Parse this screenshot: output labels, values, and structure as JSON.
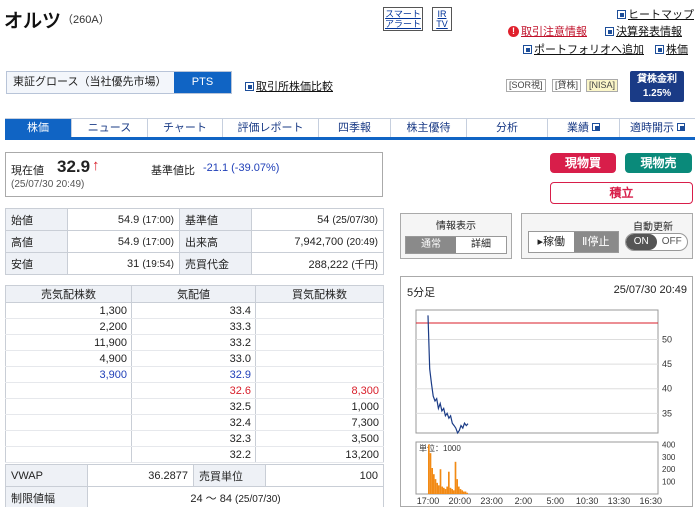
{
  "header": {
    "name": "オルツ",
    "code": "（260A）",
    "smart_alert": [
      "スマート",
      "アラート"
    ],
    "irtv": [
      "IR",
      "TV"
    ],
    "links": {
      "heatmap": "ヒートマップ",
      "caution": "取引注意情報",
      "earnings": "決算発表情報",
      "portfolio": "ポートフォリオへ追加",
      "board": "株価"
    }
  },
  "market": {
    "name": "東証グロース（当社優先市場）",
    "pts": "PTS",
    "compare": "取引所株価比較",
    "tags": [
      "[SOR視]",
      "[貸株]",
      "[NISA]"
    ],
    "lending_label": "貸株金利",
    "lending_rate": "1.25%"
  },
  "tabs": [
    "株価",
    "ニュース",
    "チャート",
    "評価レポート",
    "四季報",
    "株主優待",
    "分析",
    "業績",
    "適時開示"
  ],
  "price": {
    "label": "現在値",
    "value": "32.9",
    "arrow": "↑",
    "time": "(25/07/30 20:49)",
    "change_label": "基準値比",
    "change": "-21.1 (-39.07%)"
  },
  "buttons": {
    "buy": "現物買",
    "sell": "現物売",
    "tsumitate": "積立"
  },
  "quote": [
    {
      "l1": "始値",
      "v1": "54.9",
      "t1": "(17:00)",
      "l2": "基準値",
      "v2": "54",
      "t2": "(25/07/30)"
    },
    {
      "l1": "高値",
      "v1": "54.9",
      "t1": "(17:00)",
      "l2": "出来高",
      "v2": "7,942,700",
      "t2": "(20:49)"
    },
    {
      "l1": "安値",
      "v1": "31",
      "t1": "(19:54)",
      "l2": "売買代金",
      "v2": "288,222",
      "t2": "(千円)"
    }
  ],
  "controls": {
    "info_label": "情報表示",
    "normal": "通常",
    "detail": "詳細",
    "running": "稼働",
    "stop": "停止",
    "auto_label": "自動更新",
    "on": "ON",
    "off": "OFF"
  },
  "orderbook": {
    "headers": [
      "売気配株数",
      "気配値",
      "買気配株数"
    ],
    "rows": [
      {
        "ask": "1,300",
        "price": "33.4",
        "bid": ""
      },
      {
        "ask": "2,200",
        "price": "33.3",
        "bid": ""
      },
      {
        "ask": "11,900",
        "price": "33.2",
        "bid": ""
      },
      {
        "ask": "4,900",
        "price": "33.0",
        "bid": ""
      },
      {
        "ask": "3,900",
        "price": "32.9",
        "bid": ""
      },
      {
        "ask": "",
        "price": "32.6",
        "bid": "8,300"
      },
      {
        "ask": "",
        "price": "32.5",
        "bid": "1,000"
      },
      {
        "ask": "",
        "price": "32.4",
        "bid": "7,300"
      },
      {
        "ask": "",
        "price": "32.3",
        "bid": "3,500"
      },
      {
        "ask": "",
        "price": "32.2",
        "bid": "13,200"
      }
    ]
  },
  "vwap": {
    "label": "VWAP",
    "value": "36.2877",
    "unit_label": "売買単位",
    "unit": "100"
  },
  "limit": {
    "label": "制限値幅",
    "value": "24 〜 84",
    "date": "(25/07/30)"
  },
  "chart_data": {
    "type": "line",
    "title": "5分足",
    "timestamp": "25/07/30 20:49",
    "x": [
      "17:00",
      "17:10",
      "17:20",
      "17:30",
      "17:40",
      "17:50",
      "18:00",
      "18:10",
      "18:20",
      "18:30",
      "18:40",
      "18:50",
      "19:00",
      "19:10",
      "19:20",
      "19:30",
      "19:40",
      "19:50",
      "20:00",
      "20:10",
      "20:20",
      "20:30",
      "20:40",
      "20:49"
    ],
    "values": [
      54.9,
      44,
      41,
      38.5,
      37.5,
      38,
      36,
      37,
      35.5,
      36,
      34.5,
      35,
      34,
      34.5,
      33,
      32.5,
      32,
      31,
      31.5,
      32.5,
      32,
      33,
      32.5,
      32.9
    ],
    "yticks": [
      35,
      40,
      45,
      50
    ],
    "ylim": [
      31,
      56
    ],
    "xticks": [
      "17:00",
      "20:00",
      "23:00",
      "2:00",
      "5:00",
      "10:30",
      "13:30",
      "16:30"
    ],
    "volume_label": "単位：1000",
    "volume_yticks": [
      100,
      200,
      300,
      400
    ],
    "volume_ylim": [
      0,
      420
    ],
    "volume": [
      400,
      330,
      210,
      160,
      120,
      90,
      70,
      200,
      60,
      50,
      40,
      60,
      180,
      50,
      40,
      30,
      260,
      120,
      60,
      40,
      30,
      20,
      20,
      10
    ]
  }
}
